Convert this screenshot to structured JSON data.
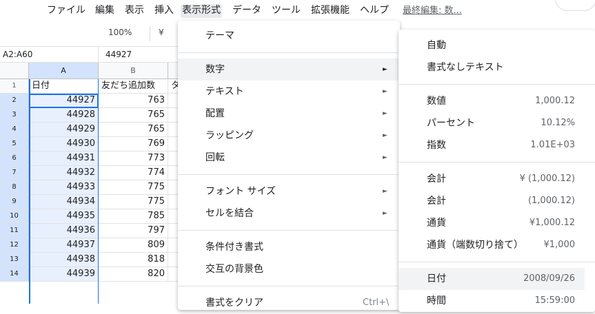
{
  "menubar": {
    "items": [
      "ファイル",
      "編集",
      "表示",
      "挿入",
      "表示形式",
      "データ",
      "ツール",
      "拡張機能",
      "ヘルプ"
    ],
    "active_index": 4,
    "last_edit": "最終編集: 数..."
  },
  "toolbar": {
    "zoom": "100%",
    "currency": "¥"
  },
  "formula_bar": {
    "name_box": "A2:A60",
    "value": "44927"
  },
  "grid": {
    "columns": [
      "A",
      "B"
    ],
    "header_row": {
      "row": "1",
      "a": "日付",
      "b": "友だち追加数",
      "c": "タ"
    },
    "rows": [
      {
        "row": "2",
        "a": "44927",
        "b": "763"
      },
      {
        "row": "3",
        "a": "44928",
        "b": "765"
      },
      {
        "row": "4",
        "a": "44929",
        "b": "765"
      },
      {
        "row": "5",
        "a": "44930",
        "b": "769"
      },
      {
        "row": "6",
        "a": "44931",
        "b": "773"
      },
      {
        "row": "7",
        "a": "44932",
        "b": "774"
      },
      {
        "row": "8",
        "a": "44933",
        "b": "775"
      },
      {
        "row": "9",
        "a": "44934",
        "b": "775"
      },
      {
        "row": "10",
        "a": "44935",
        "b": "785"
      },
      {
        "row": "11",
        "a": "44936",
        "b": "797"
      },
      {
        "row": "12",
        "a": "44937",
        "b": "809"
      },
      {
        "row": "13",
        "a": "44938",
        "b": "818"
      },
      {
        "row": "14",
        "a": "44939",
        "b": "820"
      }
    ]
  },
  "format_menu": {
    "theme": "テーマ",
    "number": "数字",
    "text": "テキスト",
    "alignment": "配置",
    "wrapping": "ラッピング",
    "rotation": "回転",
    "font_size": "フォント サイズ",
    "merge_cells": "セルを結合",
    "conditional": "条件付き書式",
    "alternating": "交互の背景色",
    "clear": "書式をクリア",
    "clear_shortcut": "Ctrl+\\",
    "arrow": "►"
  },
  "number_menu": {
    "automatic": "自動",
    "plain_text": "書式なしテキスト",
    "items": [
      {
        "label": "数値",
        "example": "1,000.12"
      },
      {
        "label": "パーセント",
        "example": "10.12%"
      },
      {
        "label": "指数",
        "example": "1.01E+03"
      },
      {
        "label": "会計",
        "example": "¥ (1,000.12)"
      },
      {
        "label": "会計",
        "example": "(1,000.12)"
      },
      {
        "label": "通貨",
        "example": "¥1,000.12"
      },
      {
        "label": "通貨（端数切り捨て）",
        "example": "¥1,000"
      },
      {
        "label": "日付",
        "example": "2008/09/26"
      },
      {
        "label": "時間",
        "example": "15:59:00"
      }
    ]
  }
}
